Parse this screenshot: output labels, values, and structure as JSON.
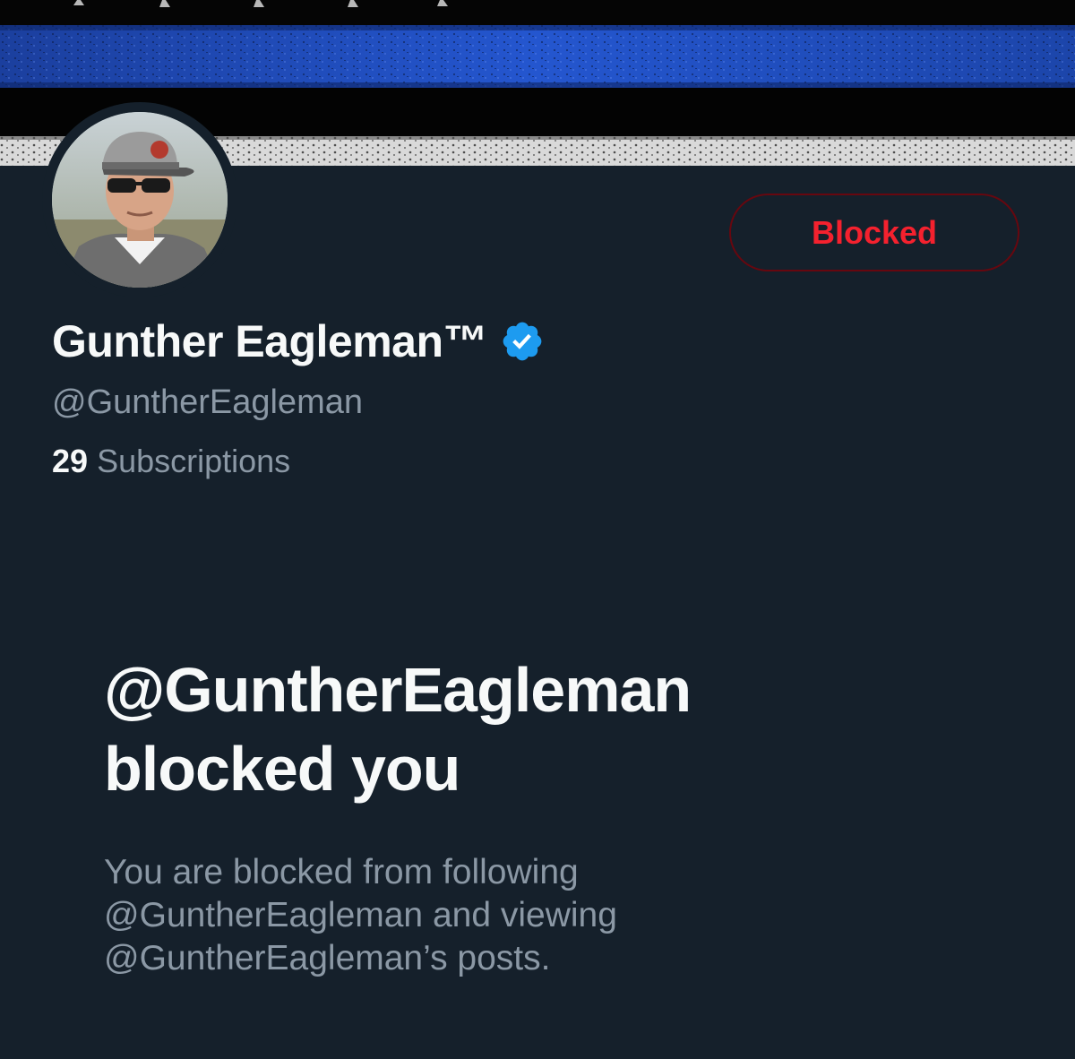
{
  "profile": {
    "display_name": "Gunther Eagleman™",
    "handle": "@GuntherEagleman",
    "subscriptions_count": "29",
    "subscriptions_label": "Subscriptions",
    "verified_icon": "verified-badge-icon",
    "avatar": "profile-avatar"
  },
  "actions": {
    "blocked_label": "Blocked"
  },
  "blocked_notice": {
    "title_line1": "@GuntherEagleman",
    "title_line2": "blocked you",
    "desc_line1": "You are blocked from following",
    "desc_line2": "@GuntherEagleman and viewing",
    "desc_line3": "@GuntherEagleman’s posts."
  },
  "colors": {
    "background": "#15202b",
    "text_primary": "#f7f9f9",
    "text_secondary": "#8b98a5",
    "blocked_red": "#f4212e",
    "blocked_border": "#67070f",
    "verified_blue": "#1d9bf0",
    "banner_blue": "#1f4fbf"
  }
}
